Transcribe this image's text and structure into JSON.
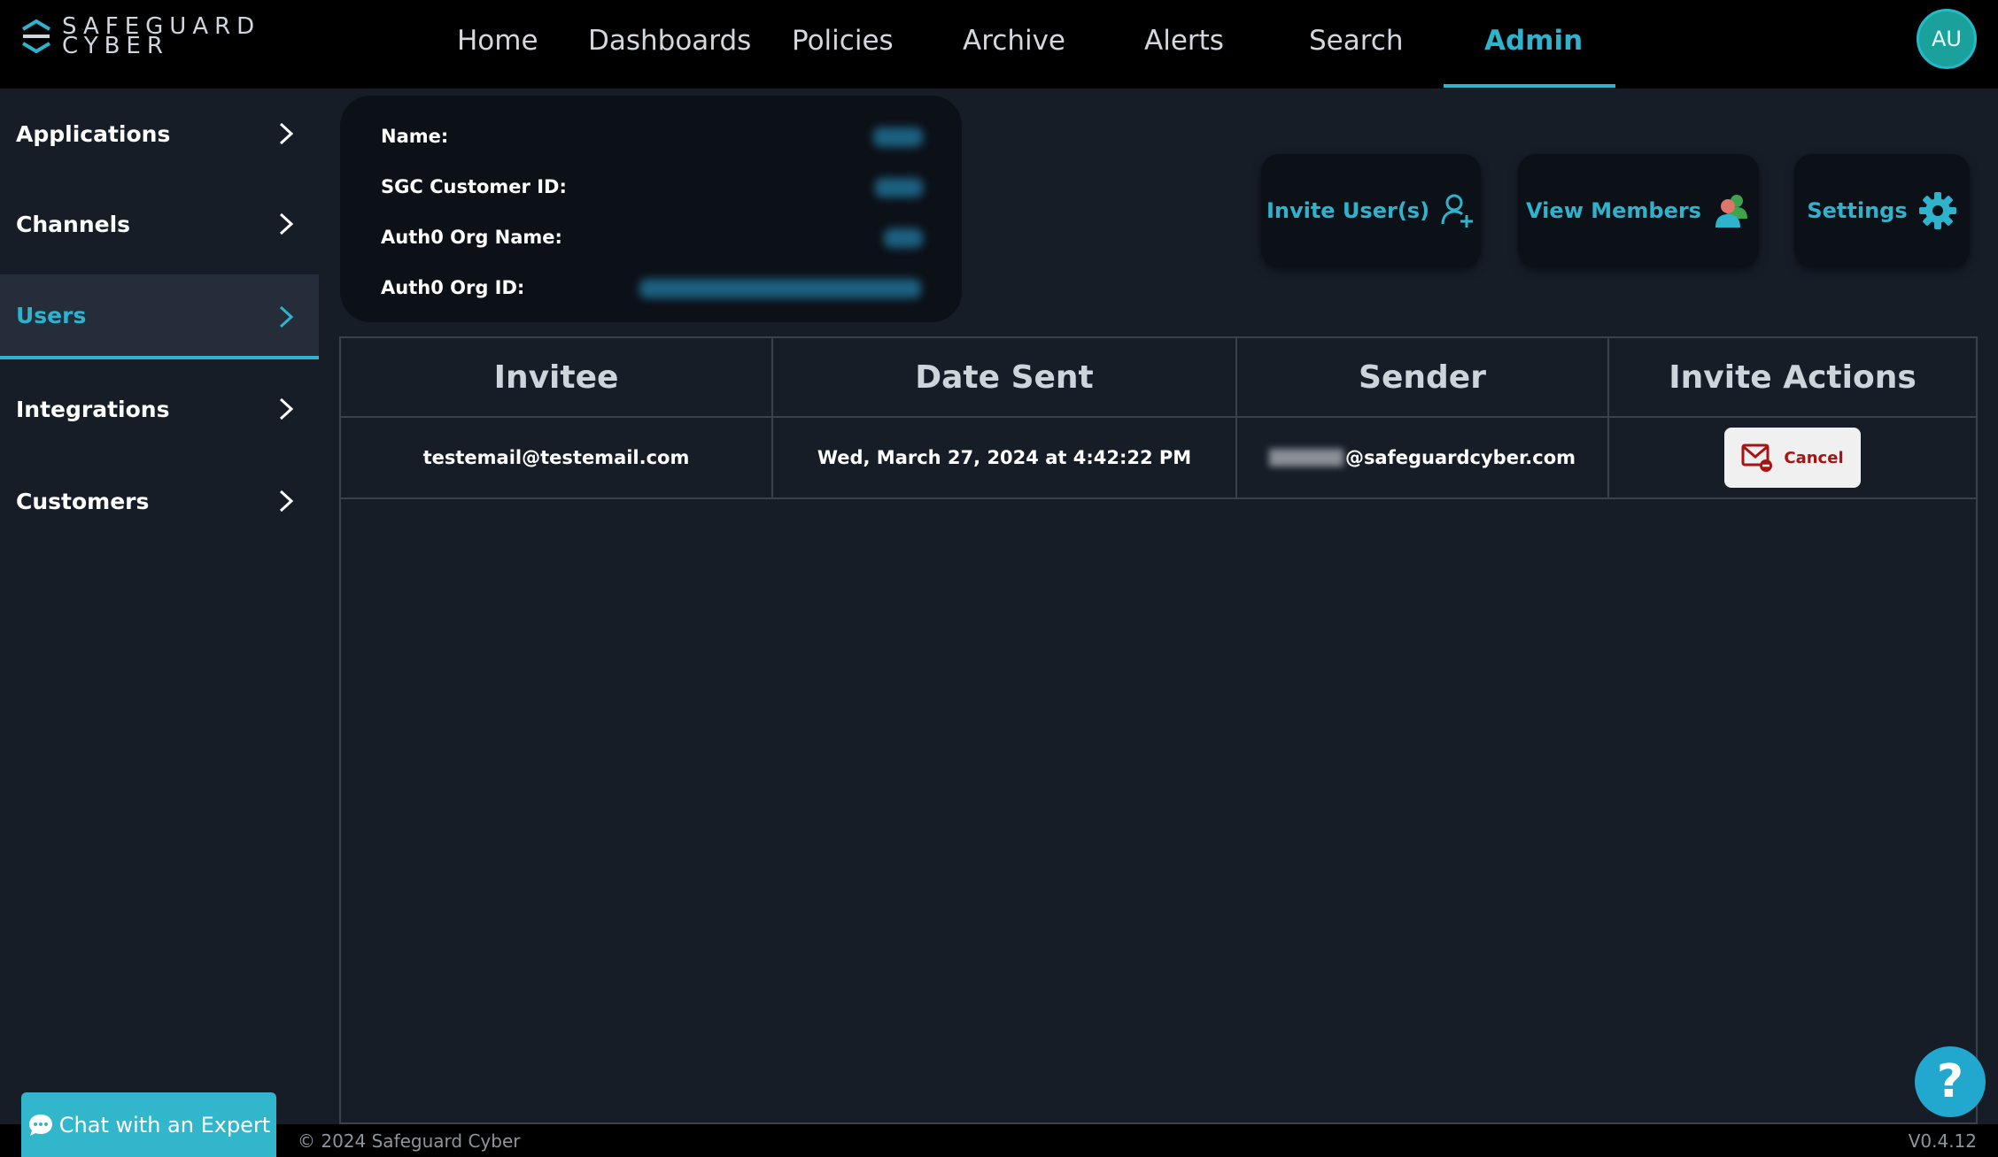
{
  "brand": {
    "line1": "SAFEGUARD",
    "line2": "CYBER"
  },
  "nav": {
    "items": [
      {
        "label": "Home"
      },
      {
        "label": "Dashboards"
      },
      {
        "label": "Policies"
      },
      {
        "label": "Archive"
      },
      {
        "label": "Alerts"
      },
      {
        "label": "Search"
      },
      {
        "label": "Admin",
        "active": true
      }
    ],
    "avatar_initials": "AU"
  },
  "sidebar": {
    "items": [
      {
        "label": "Applications"
      },
      {
        "label": "Channels"
      },
      {
        "label": "Users",
        "active": true
      },
      {
        "label": "Integrations"
      },
      {
        "label": "Customers"
      }
    ]
  },
  "org_info": {
    "name_label": "Name:",
    "customer_id_label": "SGC Customer ID:",
    "auth0_org_name_label": "Auth0 Org Name:",
    "auth0_org_id_label": "Auth0 Org ID:"
  },
  "actions": {
    "invite": "Invite User(s)",
    "view_members": "View Members",
    "settings": "Settings"
  },
  "table": {
    "headers": [
      "Invitee",
      "Date Sent",
      "Sender",
      "Invite Actions"
    ],
    "rows": [
      {
        "invitee": "testemail@testemail.com",
        "date_sent": "Wed, March 27, 2024 at 4:42:22 PM",
        "sender": "@safeguardcyber.com",
        "action": "Cancel"
      }
    ]
  },
  "footer": {
    "copyright": "© 2024 Safeguard Cyber",
    "version": "V0.4.12",
    "chat": "Chat with an Expert",
    "help": "?"
  },
  "colors": {
    "accent": "#2fb3cd",
    "background": "#171d27",
    "topbar": "#000000",
    "cancel_text": "#a81414"
  }
}
